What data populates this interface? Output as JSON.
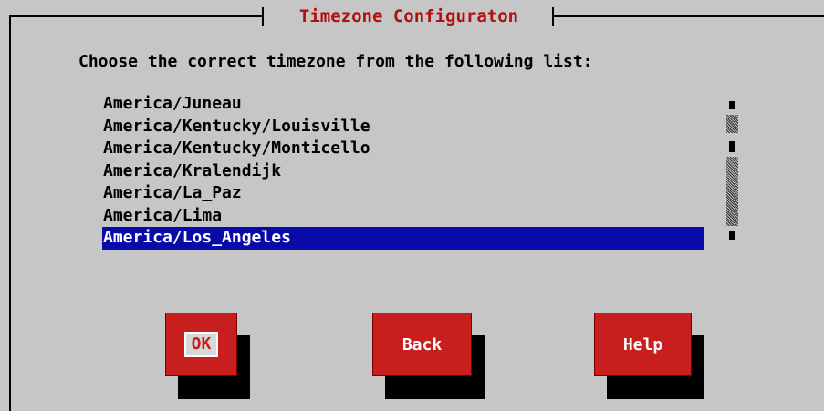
{
  "dialog": {
    "title": "Timezone Configuraton",
    "prompt": "Choose the correct timezone from the following list:"
  },
  "timezones": {
    "items": [
      "America/Juneau",
      "America/Kentucky/Louisville",
      "America/Kentucky/Monticello",
      "America/Kralendijk",
      "America/La_Paz",
      "America/Lima",
      "America/Los_Angeles"
    ],
    "selected": "America/Los_Angeles"
  },
  "buttons": {
    "ok": "OK",
    "back": "Back",
    "help": "Help"
  },
  "colors": {
    "background": "#c6c6c6",
    "title": "#b01010",
    "selection": "#0a0aa8",
    "button": "#c81e1e"
  }
}
